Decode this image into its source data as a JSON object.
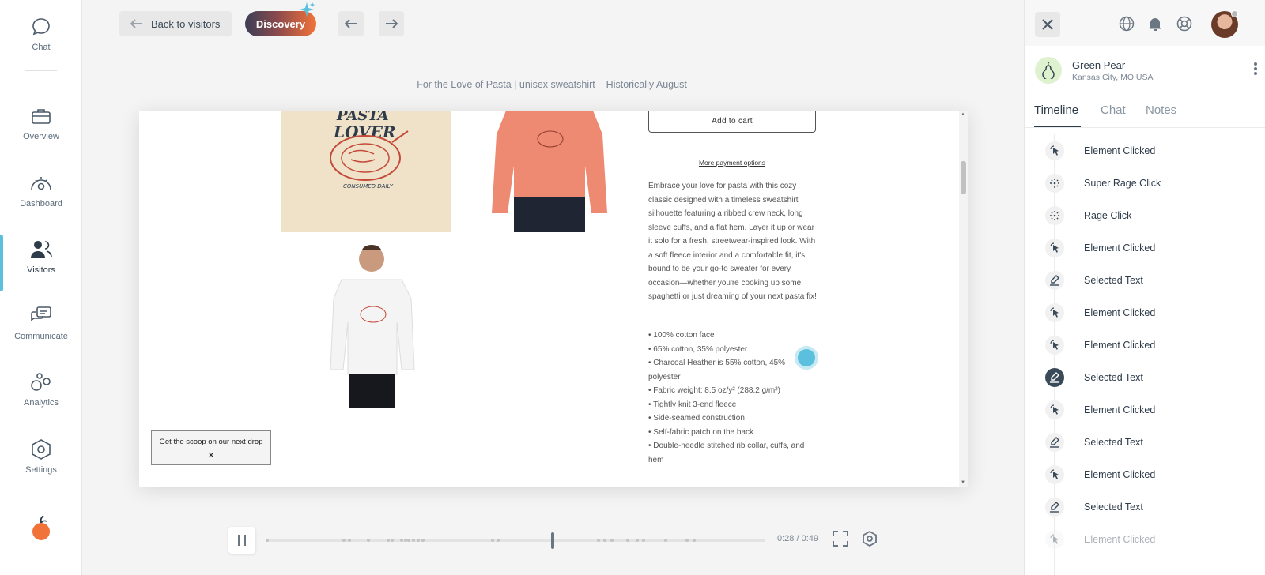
{
  "nav": {
    "items": [
      {
        "label": "Chat",
        "icon": "chat-bubble-icon"
      },
      {
        "label": "Overview",
        "icon": "briefcase-icon"
      },
      {
        "label": "Dashboard",
        "icon": "gauge-icon"
      },
      {
        "label": "Visitors",
        "icon": "users-icon"
      },
      {
        "label": "Communicate",
        "icon": "messages-icon"
      },
      {
        "label": "Analytics",
        "icon": "circles-icon"
      },
      {
        "label": "Settings",
        "icon": "hexagon-gear-icon"
      }
    ],
    "active": "Visitors",
    "accent_color": "#5bc0de",
    "brand_color": "#f2733a"
  },
  "toolbar": {
    "back_label": "Back to visitors",
    "discovery_label": "Discovery"
  },
  "page_title": "For the Love of Pasta | unisex sweatshirt – Historically August",
  "product": {
    "add_to_cart": "Add to cart",
    "more_payment": "More payment options",
    "description": "Embrace your love for pasta with this cozy classic designed with a timeless sweatshirt silhouette featuring a ribbed crew neck, long sleeve cuffs, and a flat hem. Layer it up or wear it solo for a fresh, streetwear-inspired look. With a soft fleece interior and a comfortable fit, it's bound to be your go-to sweater for every occasion—whether you're cooking up some spaghetti or just dreaming of your next pasta fix!",
    "features": [
      "• 100% cotton face",
      "• 65% cotton, 35% polyester",
      "• Charcoal Heather is 55% cotton, 45% polyester",
      "• Fabric weight: 8.5 oz/y² (288.2 g/m²)",
      "• Tightly knit 3-end fleece",
      "• Side-seamed construction",
      "• Self-fabric patch on the back",
      "• Double-needle stitched rib collar, cuffs, and hem"
    ],
    "image_text_1": "PASTA",
    "image_text_2": "LOVER",
    "image_text_3": "CONSUMED DAILY",
    "popup_text": "Get the scoop on our next drop",
    "popup_close": "✕"
  },
  "player": {
    "current_time": "0:28",
    "total_time": "0:49",
    "time_label": "0:28 / 0:49",
    "progress_fraction": 0.571
  },
  "visitor": {
    "name": "Green Pear",
    "location": "Kansas City, MO USA"
  },
  "tabs": [
    "Timeline",
    "Chat",
    "Notes"
  ],
  "active_tab": "Timeline",
  "timeline": [
    {
      "label": "Element Clicked",
      "icon": "cursor-click-icon"
    },
    {
      "label": "Super Rage Click",
      "icon": "rage-burst-icon"
    },
    {
      "label": "Rage Click",
      "icon": "rage-burst-icon"
    },
    {
      "label": "Element Clicked",
      "icon": "cursor-click-icon"
    },
    {
      "label": "Selected Text",
      "icon": "highlighter-icon"
    },
    {
      "label": "Element Clicked",
      "icon": "cursor-click-icon"
    },
    {
      "label": "Element Clicked",
      "icon": "cursor-click-icon"
    },
    {
      "label": "Selected Text",
      "icon": "highlighter-icon",
      "active": true
    },
    {
      "label": "Element Clicked",
      "icon": "cursor-click-icon"
    },
    {
      "label": "Selected Text",
      "icon": "highlighter-icon"
    },
    {
      "label": "Element Clicked",
      "icon": "cursor-click-icon"
    },
    {
      "label": "Selected Text",
      "icon": "highlighter-icon"
    },
    {
      "label": "Element Clicked",
      "icon": "cursor-click-icon"
    }
  ]
}
